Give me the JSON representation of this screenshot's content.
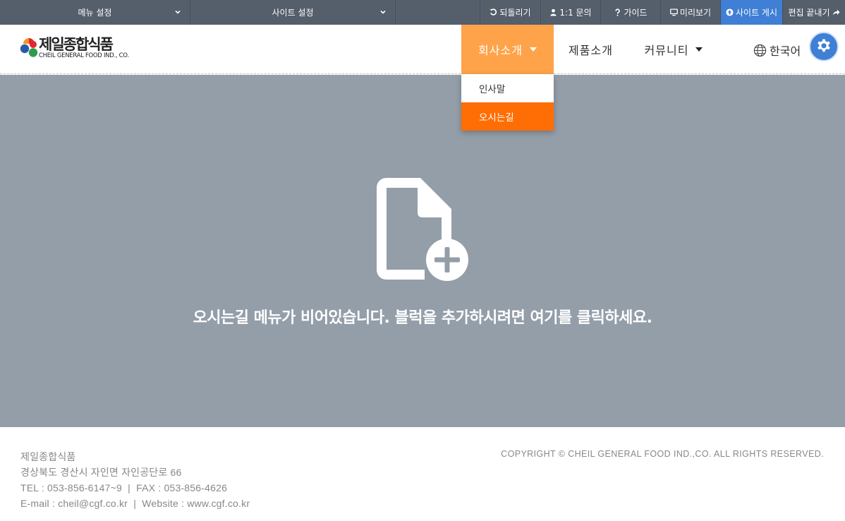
{
  "admin_bar": {
    "menu_settings": "메뉴 설정",
    "site_settings": "사이트 설정",
    "undo": "되돌리기",
    "inquiry": "1:1 문의",
    "guide": "가이드",
    "preview": "미리보기",
    "publish": "사이트 게시",
    "finish_edit": "편집 끝내기",
    "publish_color": "#3f7fd5"
  },
  "header": {
    "logo_ko": "제일종합식품",
    "logo_en": "CHEIL GENERAL FOOD IND., CO.",
    "nav": [
      {
        "label": "회사소개"
      },
      {
        "label": "제품소개"
      },
      {
        "label": "커뮤니티"
      }
    ],
    "language": "한국어",
    "accent_color": "#ffa34a"
  },
  "dropdown": {
    "items": [
      {
        "label": "인사말"
      },
      {
        "label": "오시는길"
      }
    ],
    "active_color": "#ff6e05"
  },
  "content": {
    "empty_message": "오시는길 메뉴가 비어있습니다. 블럭을 추가하시려면 여기를 클릭하세요."
  },
  "footer": {
    "company": "제일종합식품",
    "address": "경상북도 경산시 자인면 자인공단로 66",
    "tel_fax": "TEL : 053-856-6147~9  |  FAX : 053-856-4626",
    "email_web": "E-mail : cheil@cgf.co.kr  |  Website : www.cgf.co.kr",
    "copyright": "COPYRIGHT © CHEIL GENERAL FOOD IND.,CO. ALL RIGHTS RESERVED."
  }
}
